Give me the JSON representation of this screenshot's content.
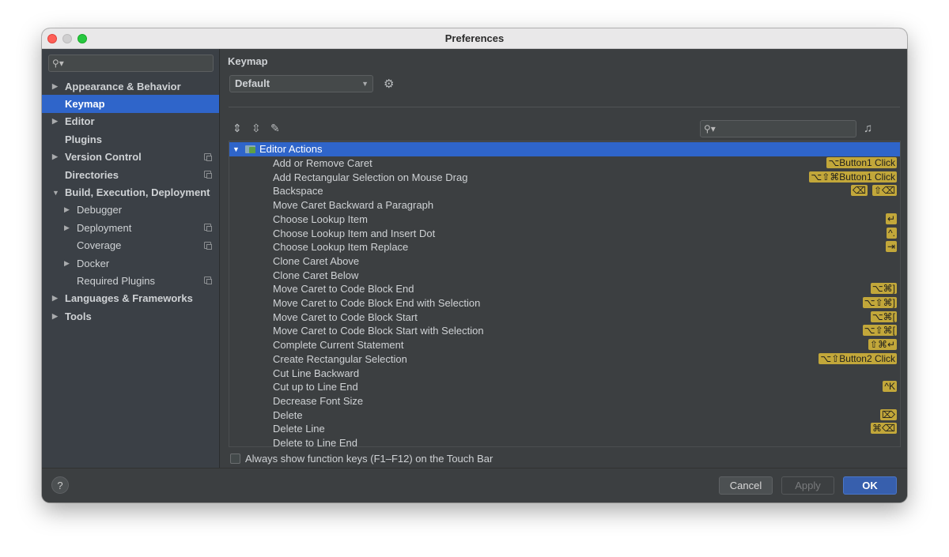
{
  "window": {
    "title": "Preferences"
  },
  "sidebar": {
    "search_icon": "search-icon",
    "items": [
      {
        "label": "Appearance & Behavior",
        "bold": true,
        "expandable": true,
        "indent": 0,
        "copy": false,
        "selected": false
      },
      {
        "label": "Keymap",
        "bold": true,
        "expandable": false,
        "indent": 0,
        "copy": false,
        "selected": true
      },
      {
        "label": "Editor",
        "bold": true,
        "expandable": true,
        "indent": 0,
        "copy": false,
        "selected": false
      },
      {
        "label": "Plugins",
        "bold": true,
        "expandable": false,
        "indent": 0,
        "copy": false,
        "selected": false
      },
      {
        "label": "Version Control",
        "bold": true,
        "expandable": true,
        "indent": 0,
        "copy": true,
        "selected": false
      },
      {
        "label": "Directories",
        "bold": true,
        "expandable": false,
        "indent": 0,
        "copy": true,
        "selected": false
      },
      {
        "label": "Build, Execution, Deployment",
        "bold": true,
        "expandable": true,
        "expanded": true,
        "indent": 0,
        "copy": false,
        "selected": false
      },
      {
        "label": "Debugger",
        "bold": false,
        "expandable": true,
        "indent": 1,
        "copy": false,
        "selected": false
      },
      {
        "label": "Deployment",
        "bold": false,
        "expandable": true,
        "indent": 1,
        "copy": true,
        "selected": false
      },
      {
        "label": "Coverage",
        "bold": false,
        "expandable": false,
        "indent": 1,
        "copy": true,
        "selected": false
      },
      {
        "label": "Docker",
        "bold": false,
        "expandable": true,
        "indent": 1,
        "copy": false,
        "selected": false
      },
      {
        "label": "Required Plugins",
        "bold": false,
        "expandable": false,
        "indent": 1,
        "copy": true,
        "selected": false
      },
      {
        "label": "Languages & Frameworks",
        "bold": true,
        "expandable": true,
        "indent": 0,
        "copy": false,
        "selected": false
      },
      {
        "label": "Tools",
        "bold": true,
        "expandable": true,
        "indent": 0,
        "copy": false,
        "selected": false
      }
    ]
  },
  "main": {
    "title": "Keymap",
    "keymap_value": "Default",
    "tree_root": "Editor Actions",
    "actions": [
      {
        "label": "Add or Remove Caret",
        "shortcuts": [
          "⌥Button1 Click"
        ]
      },
      {
        "label": "Add Rectangular Selection on Mouse Drag",
        "shortcuts": [
          "⌥⇧⌘Button1 Click"
        ]
      },
      {
        "label": "Backspace",
        "shortcuts": [
          "⌫",
          "⇧⌫"
        ]
      },
      {
        "label": "Move Caret Backward a Paragraph",
        "shortcuts": []
      },
      {
        "label": "Choose Lookup Item",
        "shortcuts": [
          "↵"
        ]
      },
      {
        "label": "Choose Lookup Item and Insert Dot",
        "shortcuts": [
          "^."
        ]
      },
      {
        "label": "Choose Lookup Item Replace",
        "shortcuts": [
          "⇥"
        ]
      },
      {
        "label": "Clone Caret Above",
        "shortcuts": []
      },
      {
        "label": "Clone Caret Below",
        "shortcuts": []
      },
      {
        "label": "Move Caret to Code Block End",
        "shortcuts": [
          "⌥⌘]"
        ]
      },
      {
        "label": "Move Caret to Code Block End with Selection",
        "shortcuts": [
          "⌥⇧⌘]"
        ]
      },
      {
        "label": "Move Caret to Code Block Start",
        "shortcuts": [
          "⌥⌘["
        ]
      },
      {
        "label": "Move Caret to Code Block Start with Selection",
        "shortcuts": [
          "⌥⇧⌘["
        ]
      },
      {
        "label": "Complete Current Statement",
        "shortcuts": [
          "⇧⌘↵"
        ]
      },
      {
        "label": "Create Rectangular Selection",
        "shortcuts": [
          "⌥⇧Button2 Click"
        ]
      },
      {
        "label": "Cut Line Backward",
        "shortcuts": []
      },
      {
        "label": "Cut up to Line End",
        "shortcuts": [
          "^K"
        ]
      },
      {
        "label": "Decrease Font Size",
        "shortcuts": []
      },
      {
        "label": "Delete",
        "shortcuts": [
          "⌦"
        ]
      },
      {
        "label": "Delete Line",
        "shortcuts": [
          "⌘⌫"
        ]
      },
      {
        "label": "Delete to Line End",
        "shortcuts": []
      }
    ],
    "touchbar_label": "Always show function keys (F1–F12) on the Touch Bar"
  },
  "footer": {
    "help_label": "?",
    "cancel_label": "Cancel",
    "apply_label": "Apply",
    "ok_label": "OK"
  },
  "colors": {
    "selection": "#2f65ca",
    "shortcut_badge": "#c2a73a",
    "ok_button": "#375fad"
  }
}
